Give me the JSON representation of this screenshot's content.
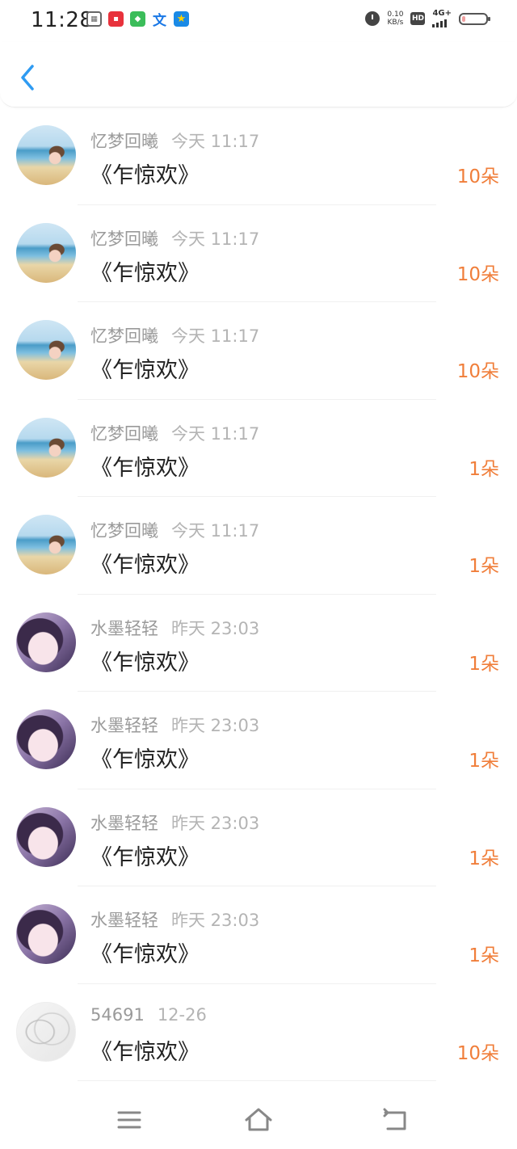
{
  "status_bar": {
    "time": "11:28",
    "net_speed_value": "0.10",
    "net_speed_unit": "KB/s",
    "hd_label": "HD",
    "network_label": "4G+",
    "battery_percent": 15,
    "app_icons": [
      "gallery-icon",
      "app-red-icon",
      "app-green-icon",
      "translate-icon",
      "app-yellow-icon"
    ]
  },
  "accent_color": "#f07e3a",
  "back_color": "#2f9bf2",
  "gifts": [
    {
      "nickname": "忆梦回曦",
      "time": "今天 11:17",
      "title": "《乍惊欢》",
      "amount": "10朵",
      "avatar": "beach"
    },
    {
      "nickname": "忆梦回曦",
      "time": "今天 11:17",
      "title": "《乍惊欢》",
      "amount": "10朵",
      "avatar": "beach"
    },
    {
      "nickname": "忆梦回曦",
      "time": "今天 11:17",
      "title": "《乍惊欢》",
      "amount": "10朵",
      "avatar": "beach"
    },
    {
      "nickname": "忆梦回曦",
      "time": "今天 11:17",
      "title": "《乍惊欢》",
      "amount": "1朵",
      "avatar": "beach"
    },
    {
      "nickname": "忆梦回曦",
      "time": "今天 11:17",
      "title": "《乍惊欢》",
      "amount": "1朵",
      "avatar": "beach"
    },
    {
      "nickname": "水墨轻轻",
      "time": "昨天 23:03",
      "title": "《乍惊欢》",
      "amount": "1朵",
      "avatar": "girl"
    },
    {
      "nickname": "水墨轻轻",
      "time": "昨天 23:03",
      "title": "《乍惊欢》",
      "amount": "1朵",
      "avatar": "girl"
    },
    {
      "nickname": "水墨轻轻",
      "time": "昨天 23:03",
      "title": "《乍惊欢》",
      "amount": "1朵",
      "avatar": "girl"
    },
    {
      "nickname": "水墨轻轻",
      "time": "昨天 23:03",
      "title": "《乍惊欢》",
      "amount": "1朵",
      "avatar": "girl"
    },
    {
      "nickname": "54691",
      "time": "12-26",
      "title": "《乍惊欢》",
      "amount": "10朵",
      "avatar": "sketch"
    }
  ],
  "nav": {
    "menu_icon": "menu-icon",
    "home_icon": "home-icon",
    "back_icon": "back-icon"
  }
}
